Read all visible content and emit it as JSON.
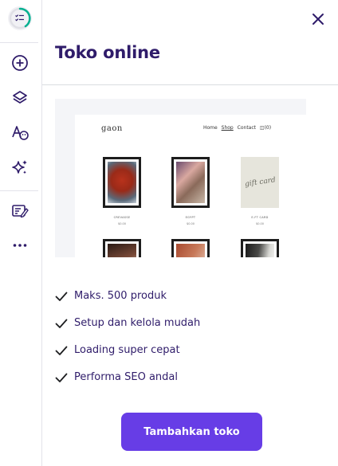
{
  "sidebar": {
    "items": [
      {
        "icon": "checklist-progress-icon"
      },
      {
        "icon": "plus-circle-icon"
      },
      {
        "icon": "layers-icon"
      },
      {
        "icon": "typography-palette-icon"
      },
      {
        "icon": "sparkles-icon"
      },
      {
        "icon": "edit-list-icon"
      },
      {
        "icon": "more-dots-icon"
      }
    ]
  },
  "panel": {
    "title": "Toko online",
    "close_icon": "close-icon"
  },
  "preview": {
    "site_logo": "gaon",
    "nav": [
      "Home",
      "Shop",
      "Contact"
    ],
    "cart": "(0)",
    "products": [
      {
        "name": "CREVASSE",
        "price": "$0.00"
      },
      {
        "name": "EGYPT",
        "price": "$0.00"
      },
      {
        "name": "E-FT CARD",
        "price": "$0.00"
      }
    ],
    "gift_text": "gift card"
  },
  "features": [
    "Maks. 500 produk",
    "Setup dan kelola mudah",
    "Loading super cepat",
    "Performa SEO andal"
  ],
  "cta": {
    "label": "Tambahkan toko"
  },
  "colors": {
    "accent": "#673de6",
    "text": "#2f1c6a",
    "progress": "#00b090"
  }
}
